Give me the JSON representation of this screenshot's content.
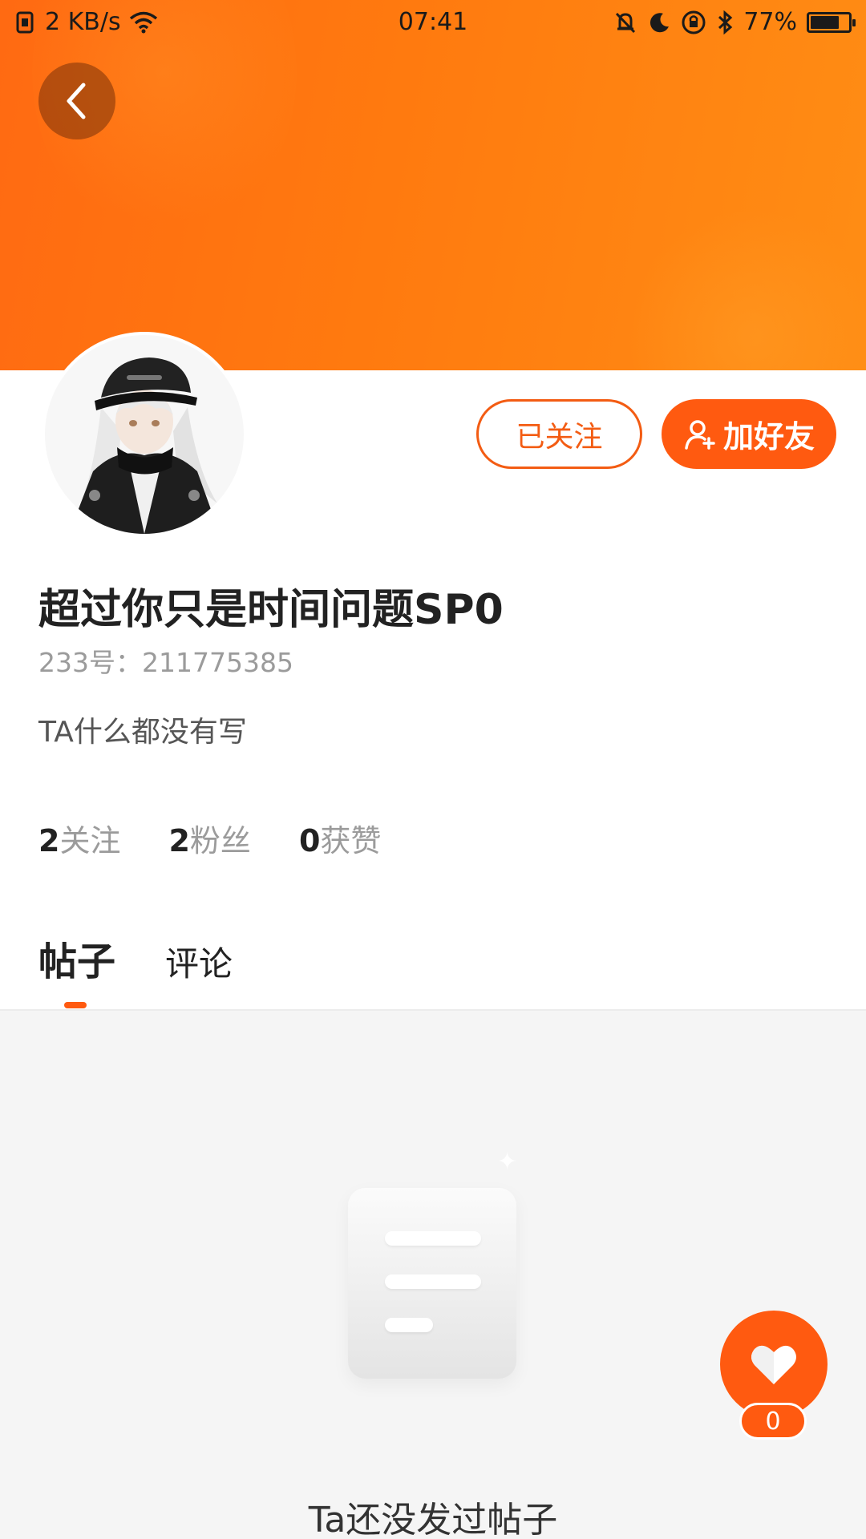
{
  "status_bar": {
    "net_speed": "2 KB/s",
    "time": "07:41",
    "battery": "77%",
    "battery_level": 0.77
  },
  "profile": {
    "username": "超过你只是时间问题SP0",
    "id_text": "233号：211775385",
    "bio": "TA什么都没有写",
    "avatar_icon": "anime-avatar"
  },
  "actions": {
    "followed_label": "已关注",
    "add_friend_label": "加好友"
  },
  "stats": [
    {
      "value": "2",
      "label": "关注"
    },
    {
      "value": "2",
      "label": "粉丝"
    },
    {
      "value": "0",
      "label": "获赞"
    }
  ],
  "tabs": [
    {
      "label": "帖子",
      "active": true
    },
    {
      "label": "评论",
      "active": false
    }
  ],
  "empty_state": {
    "text": "Ta还没发过帖子",
    "icon": "empty-document-icon"
  },
  "like": {
    "count": "0",
    "icon": "heart-icon"
  },
  "colors": {
    "accent": "#ff5a10",
    "header_gradient_start": "#ff6a12",
    "header_gradient_end": "#ff8d14"
  }
}
